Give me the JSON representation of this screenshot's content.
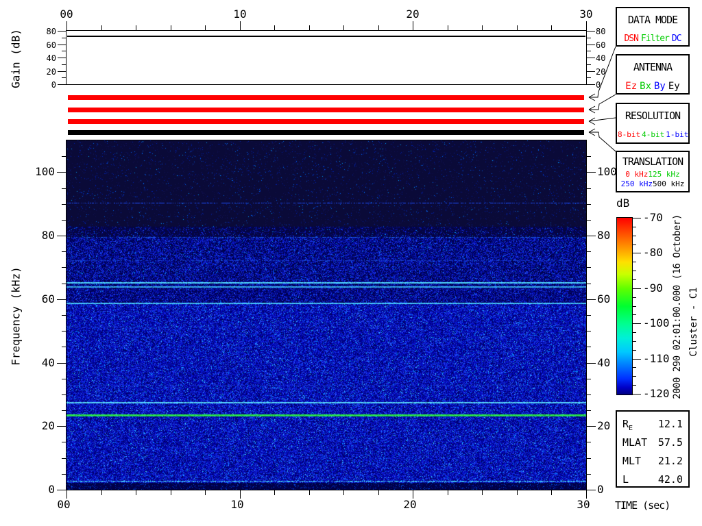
{
  "gain_axis": {
    "label": "Gain (dB)",
    "ticks": [
      "0",
      "20",
      "40",
      "60",
      "80"
    ]
  },
  "freq_axis": {
    "label": "Frequency (kHz)",
    "ticks": [
      "0",
      "20",
      "40",
      "60",
      "80",
      "100"
    ]
  },
  "time_axis": {
    "label": "TIME (sec)",
    "ticks": [
      "00",
      "10",
      "20",
      "30"
    ]
  },
  "colorbar": {
    "label": "dB",
    "ticks": [
      "-70",
      "-80",
      "-90",
      "-100",
      "-110",
      "-120"
    ],
    "min": -120,
    "max": -70
  },
  "side_text": {
    "datetime": "2000 290 02:01:00.000 (16 October)",
    "spacecraft": "Cluster - C1"
  },
  "legend_boxes": [
    {
      "title": "DATA MODE",
      "items": [
        {
          "label": "DSN",
          "color": "#ff0000"
        },
        {
          "label": "Filter",
          "color": "#00cc00"
        },
        {
          "label": "DC",
          "color": "#0000ff"
        }
      ]
    },
    {
      "title": "ANTENNA",
      "items": [
        {
          "label": "Ez",
          "color": "#ff0000"
        },
        {
          "label": "Bx",
          "color": "#00cc00"
        },
        {
          "label": "By",
          "color": "#0000ff"
        },
        {
          "label": "Ey",
          "color": "#000000"
        }
      ]
    },
    {
      "title": "RESOLUTION",
      "items": [
        {
          "label": "8-bit",
          "color": "#ff0000"
        },
        {
          "label": "4-bit",
          "color": "#00cc00"
        },
        {
          "label": "1-bit",
          "color": "#0000ff"
        }
      ]
    },
    {
      "title": "TRANSLATION",
      "items": [
        {
          "label": "0 kHz",
          "color": "#ff0000"
        },
        {
          "label": "125 kHz",
          "color": "#00cc00"
        },
        {
          "label": "250 kHz",
          "color": "#0000ff"
        },
        {
          "label": "500 kHz",
          "color": "#000000"
        }
      ]
    }
  ],
  "status_bars": [
    {
      "name": "data-mode-bar",
      "color": "#ff0000",
      "points_to": "DATA MODE"
    },
    {
      "name": "antenna-bar",
      "color": "#ff0000",
      "points_to": "ANTENNA"
    },
    {
      "name": "resolution-bar",
      "color": "#ff0000",
      "points_to": "RESOLUTION"
    },
    {
      "name": "translation-bar",
      "color": "#000000",
      "points_to": "TRANSLATION"
    }
  ],
  "info_box": {
    "rows": [
      {
        "label": "R",
        "sub": "E",
        "value": "12.1"
      },
      {
        "label": "MLAT",
        "sub": "",
        "value": "57.5"
      },
      {
        "label": "MLT",
        "sub": "",
        "value": "21.2"
      },
      {
        "label": "L",
        "sub": "",
        "value": "42.0"
      }
    ]
  },
  "chart_data": [
    {
      "type": "line",
      "title": "Receiver gain vs time",
      "ylabel": "Gain (dB)",
      "xlabel": "",
      "xlim": [
        0,
        30
      ],
      "ylim": [
        0,
        80
      ],
      "x": [
        0,
        30
      ],
      "series": [
        {
          "name": "gain",
          "values": [
            73,
            73
          ]
        }
      ]
    },
    {
      "type": "heatmap",
      "title": "Cluster C1 WBD spectrogram, 2000 290 02:01:00.000 (16 October)",
      "xlabel": "TIME (sec)",
      "ylabel": "Frequency (kHz)",
      "xlim": [
        0,
        30
      ],
      "ylim": [
        0,
        110
      ],
      "colorbar": {
        "label": "dB",
        "min": -120,
        "max": -70
      },
      "background_regions": [
        {
          "f0": 0,
          "f1": 2.2,
          "palette": [
            [
              "#000048",
              0.86
            ],
            [
              "#0018a0",
              0.1
            ],
            [
              "#0050e0",
              0.04
            ]
          ]
        },
        {
          "f0": 2.2,
          "f1": 58.5,
          "palette": [
            [
              "#000068",
              0.27
            ],
            [
              "#0000a8",
              0.26
            ],
            [
              "#0714cc",
              0.2
            ],
            [
              "#1830e8",
              0.15
            ],
            [
              "#2a52ff",
              0.07
            ],
            [
              "#0090ff",
              0.035
            ],
            [
              "#40d0ff",
              0.015
            ]
          ]
        },
        {
          "f0": 58.5,
          "f1": 63.6,
          "palette": [
            [
              "#000050",
              0.46
            ],
            [
              "#000898",
              0.24
            ],
            [
              "#0a18c8",
              0.16
            ],
            [
              "#1830e8",
              0.09
            ],
            [
              "#2a52ff",
              0.035
            ],
            [
              "#0090ff",
              0.015
            ]
          ]
        },
        {
          "f0": 63.6,
          "f1": 79.5,
          "palette": [
            [
              "#000048",
              0.4
            ],
            [
              "#000890",
              0.26
            ],
            [
              "#0a18c8",
              0.18
            ],
            [
              "#1830e8",
              0.1
            ],
            [
              "#2a52ff",
              0.04
            ],
            [
              "#0090ff",
              0.02
            ]
          ]
        },
        {
          "f0": 79.5,
          "f1": 83,
          "palette": [
            [
              "#050540",
              0.73
            ],
            [
              "#000878",
              0.15
            ],
            [
              "#0a18c0",
              0.08
            ],
            [
              "#2040e8",
              0.03
            ],
            [
              "#0090ff",
              0.01
            ]
          ]
        },
        {
          "f0": 83,
          "f1": 110,
          "palette": [
            [
              "#0a0a38",
              0.935
            ],
            [
              "#101050",
              0.04
            ],
            [
              "#0020a8",
              0.018
            ],
            [
              "#0060e8",
              0.006
            ],
            [
              "#00a0ff",
              0.001
            ]
          ]
        }
      ],
      "spectral_lines": [
        {
          "freq_khz": 90.2,
          "color": "#2050ff",
          "width": 1,
          "style": "speckled"
        },
        {
          "freq_khz": 79.5,
          "color": "#2060f0",
          "width": 1,
          "style": "speckled"
        },
        {
          "freq_khz": 72.2,
          "color": "#1840d0",
          "width": 1,
          "style": "speckled"
        },
        {
          "freq_khz": 65.2,
          "color": "#50d8ff",
          "width": 2,
          "style": "solid"
        },
        {
          "freq_khz": 63.8,
          "color": "#38b0f0",
          "width": 2,
          "style": "solid"
        },
        {
          "freq_khz": 58.6,
          "color": "#48ccff",
          "width": 2,
          "style": "solid"
        },
        {
          "freq_khz": 51.3,
          "color": "#1838c8",
          "width": 1,
          "style": "speckled"
        },
        {
          "freq_khz": 32.8,
          "color": "#1838c8",
          "width": 1,
          "style": "speckled"
        },
        {
          "freq_khz": 27.4,
          "color": "#58d8ff",
          "width": 2,
          "style": "solid"
        },
        {
          "freq_khz": 23.3,
          "color": "#2ae850",
          "width": 3,
          "style": "solid"
        },
        {
          "freq_khz": 2.5,
          "color": "#40c0f0",
          "width": 2,
          "style": "speckled"
        }
      ]
    }
  ]
}
